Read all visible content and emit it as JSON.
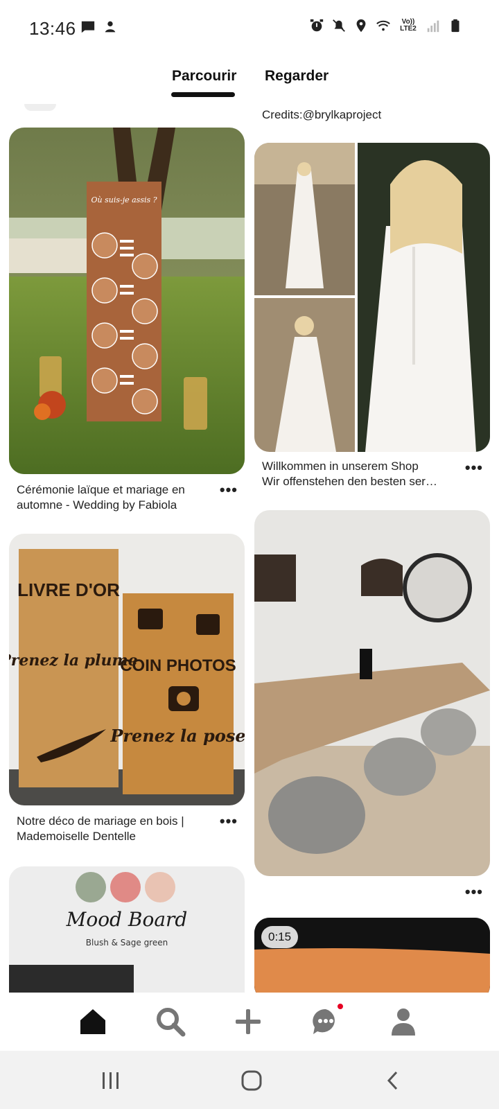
{
  "status_bar": {
    "time": "13:46",
    "network_label": "Vo)) LTE2",
    "icons": [
      "message-icon",
      "notification-app-icon",
      "alarm-icon",
      "mute-icon",
      "location-icon",
      "wifi-icon",
      "signal-icon",
      "battery-icon"
    ]
  },
  "tabs": [
    {
      "label": "Parcourir",
      "active": true
    },
    {
      "label": "Regarder",
      "active": false
    }
  ],
  "feed": {
    "left_column": [
      {
        "title": "Cérémonie laïque et mariage en automne - Wedding by Fabiola",
        "image": "wedding-seating-board-photo",
        "more": "•••"
      },
      {
        "title": "Notre déco de mariage en bois | Mademoiselle Dentelle",
        "image": "wooden-signs-photo",
        "more": "•••"
      },
      {
        "title": "",
        "image": "mood-board-photo",
        "image_text": {
          "heading": "Mood Board",
          "subheading": "Blush & Sage green"
        },
        "swatches": [
          "#9aa892",
          "#e08a86",
          "#e9c3b3"
        ]
      }
    ],
    "right_column": [
      {
        "credits": "Credits:@brylkaproject"
      },
      {
        "title_line1": "Willkommen in unserem Shop",
        "title_line2": "Wir offenstehen den besten ser…",
        "image": "wedding-dress-collage-photo",
        "more": "•••"
      },
      {
        "title": "",
        "image": "dining-room-photo",
        "more": "•••"
      },
      {
        "video_duration": "0:15",
        "image": "video-pin-photo"
      }
    ],
    "sign_texts": {
      "guestbook_title": "LIVRE D'OR",
      "guestbook_sub": "Prenez la plume",
      "photo_title": "COIN PHOTOS",
      "photo_sub": "Prenez la pose",
      "seating_text": "Où suis-je assis ?"
    }
  },
  "bottom_nav": {
    "items": [
      "home-icon",
      "search-icon",
      "add-icon",
      "messages-icon",
      "profile-icon"
    ],
    "active": "home-icon",
    "has_notification": "messages-icon"
  },
  "system_nav": [
    "recent-apps-icon",
    "home-circle-icon",
    "back-icon"
  ]
}
